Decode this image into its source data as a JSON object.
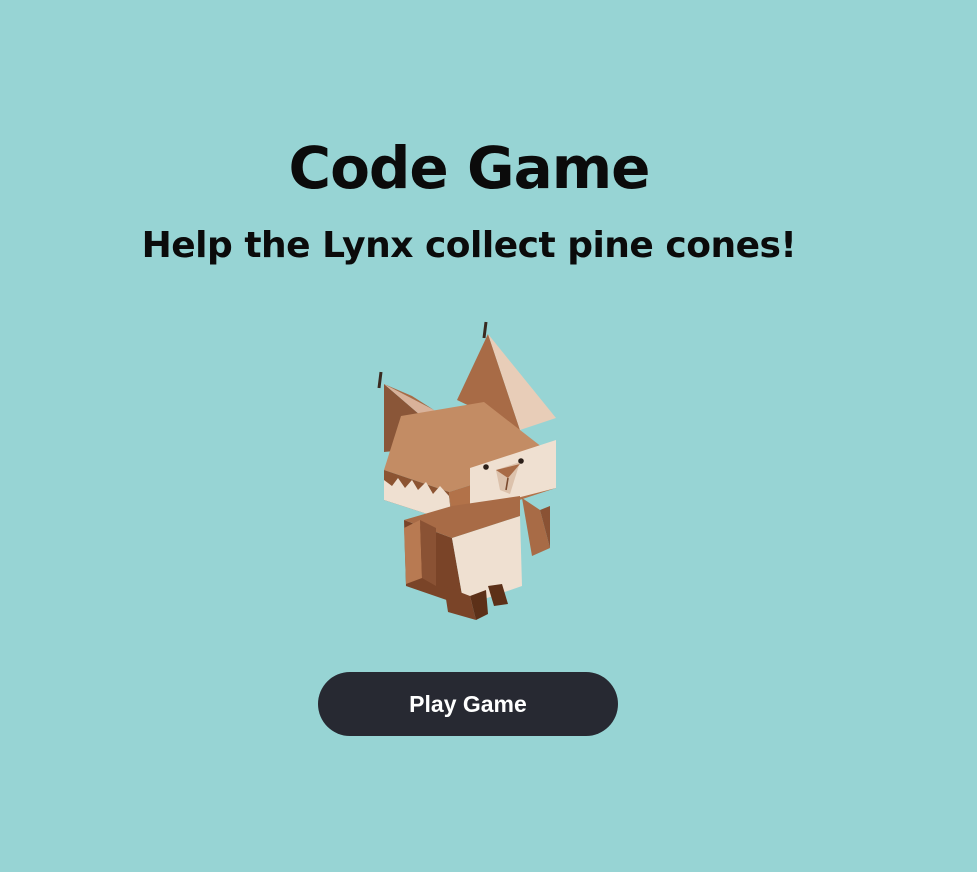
{
  "page": {
    "title": "Code Game",
    "subtitle": "Help the Lynx collect pine cones!"
  },
  "mascot": {
    "icon": "lynx-mascot-icon"
  },
  "actions": {
    "play_label": "Play Game"
  },
  "colors": {
    "background": "#97d4d4",
    "button": "#272932",
    "button_text": "#ffffff",
    "text": "#0b0b0b"
  }
}
